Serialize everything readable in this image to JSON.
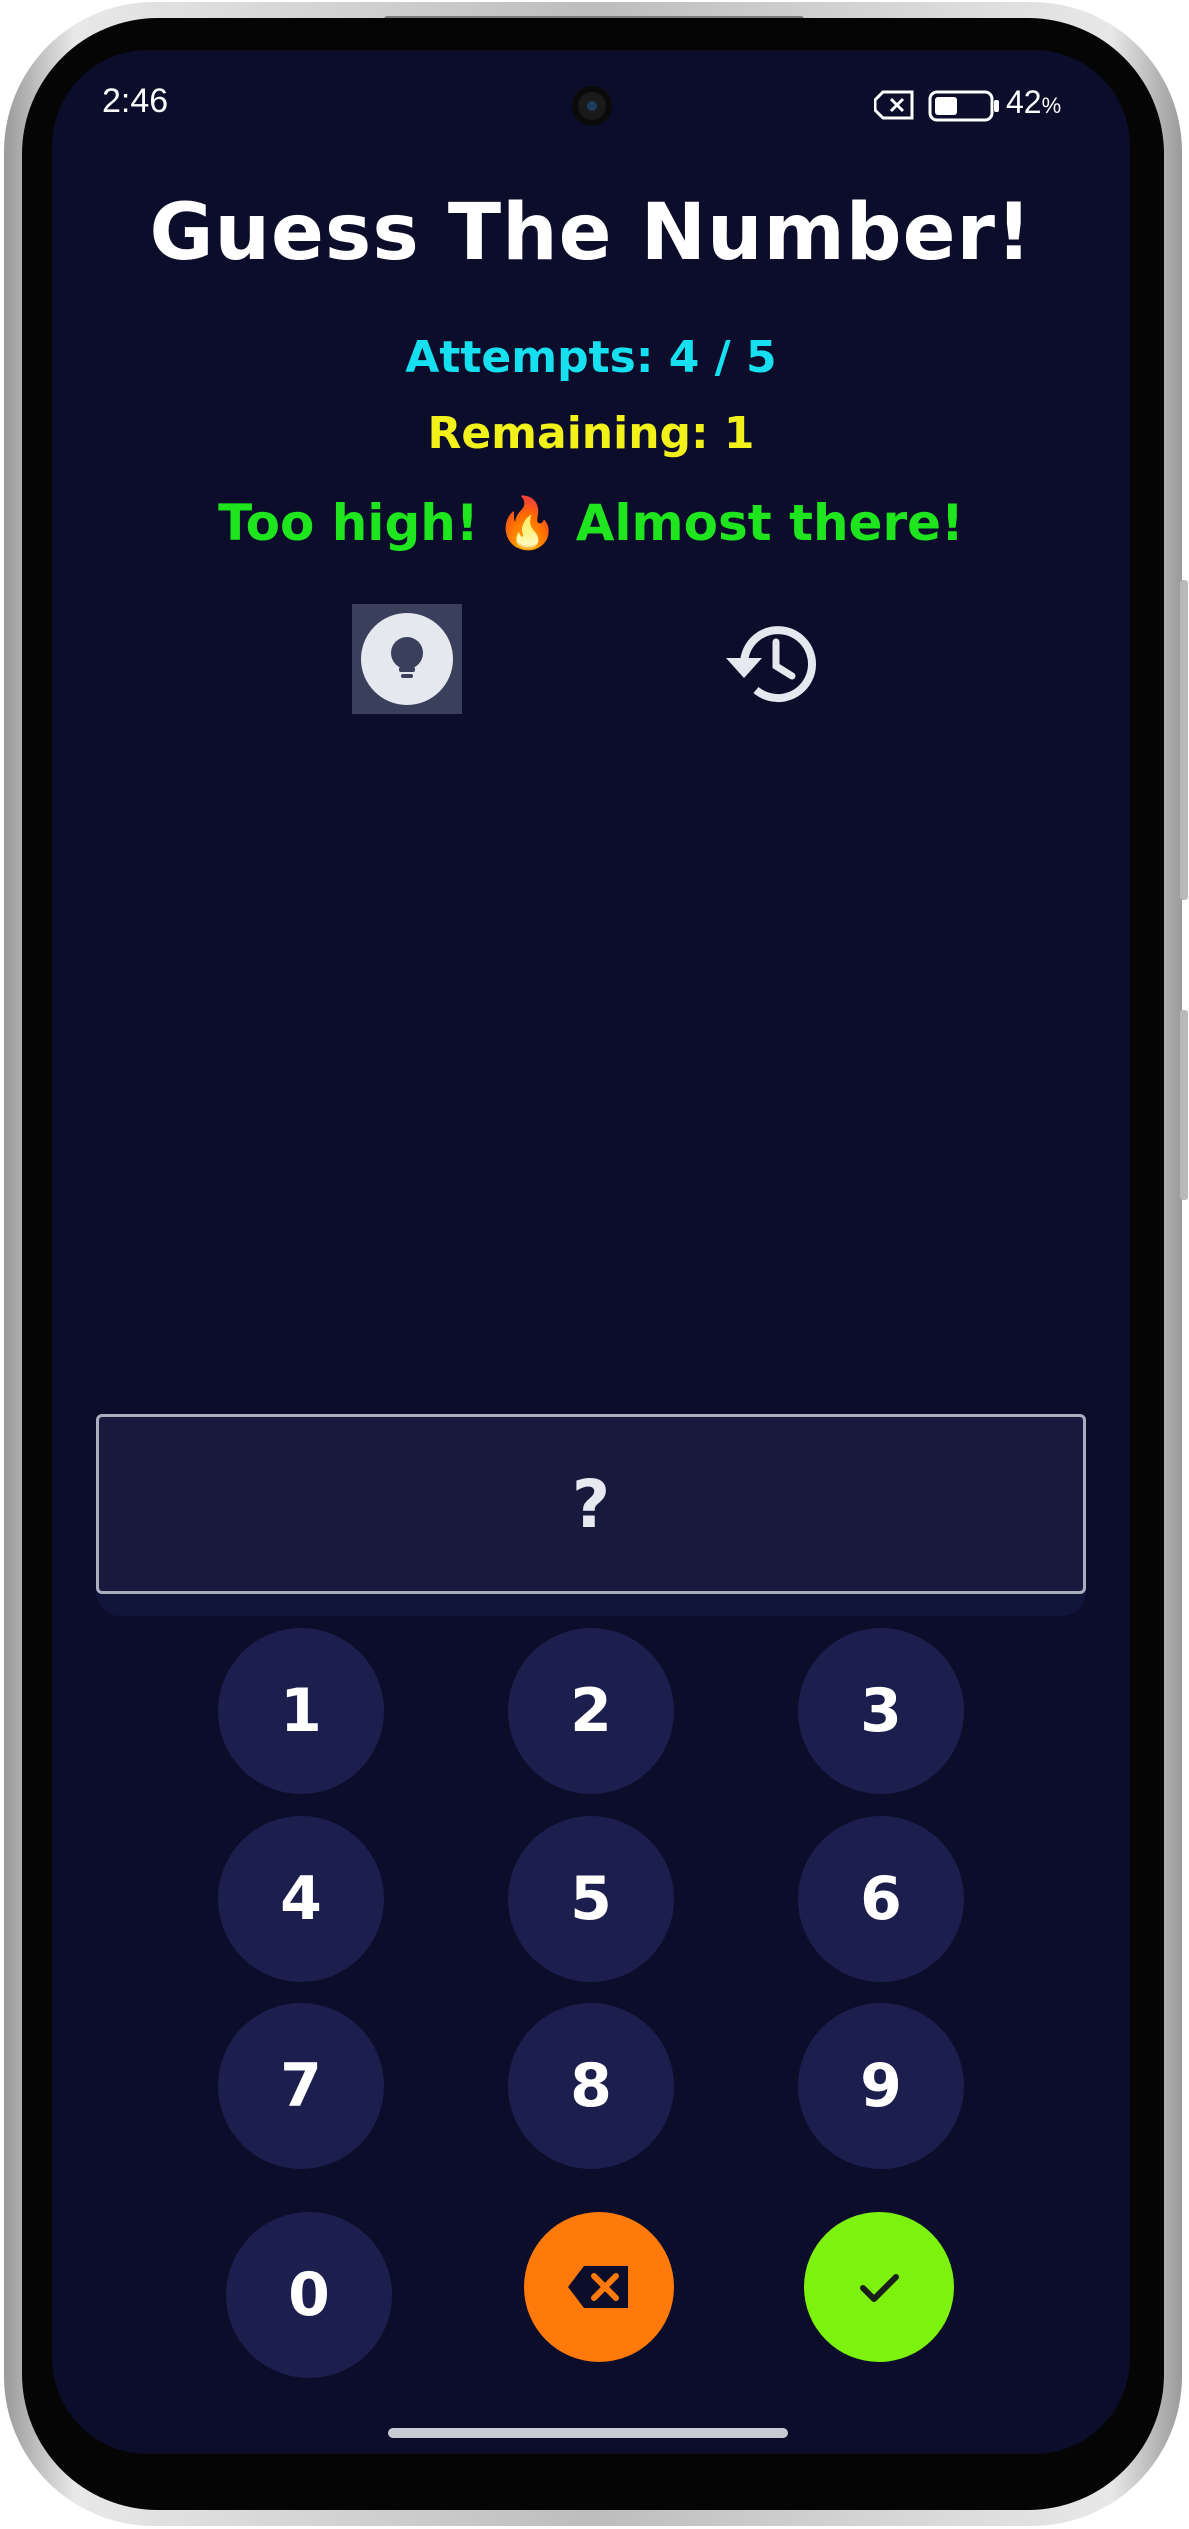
{
  "status_bar": {
    "time": "2:46",
    "battery_percent": "42",
    "battery_unit": "%",
    "battery_level": 0.42,
    "sim_icon": "sim-off-icon",
    "battery_icon": "battery-icon"
  },
  "game": {
    "title": "Guess The Number!",
    "attempts": "Attempts: 4 / 5",
    "remaining": "Remaining: 1",
    "feedback": "Too high! 🔥 Almost there!",
    "guess_display": "?"
  },
  "actions": {
    "hint_icon": "lightbulb-icon",
    "history_icon": "history-icon"
  },
  "keypad": {
    "k1": "1",
    "k2": "2",
    "k3": "3",
    "k4": "4",
    "k5": "5",
    "k6": "6",
    "k7": "7",
    "k8": "8",
    "k9": "9",
    "k0": "0",
    "delete_icon": "backspace-icon",
    "submit_icon": "checkmark-icon"
  },
  "colors": {
    "background": "#0b0d2a",
    "title": "#ffffff",
    "attempts": "#16e0f0",
    "remaining": "#f2f21a",
    "feedback": "#1ee51e",
    "key": "#1c1f4e",
    "delete": "#ff7a0a",
    "submit": "#7df20f"
  }
}
